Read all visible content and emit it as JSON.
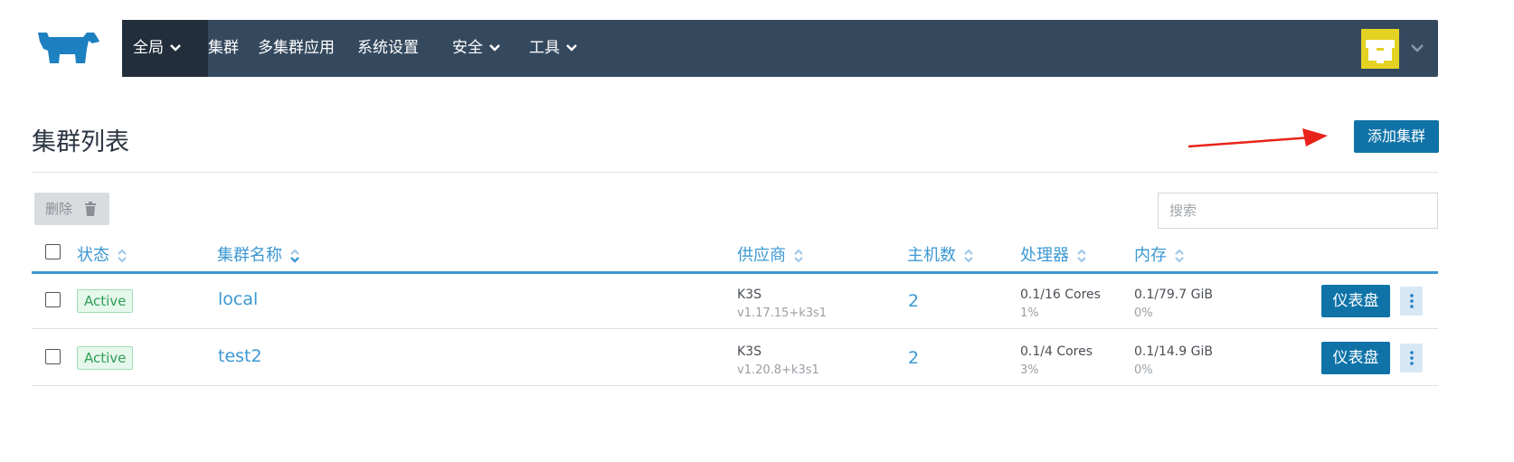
{
  "nav": {
    "items": [
      {
        "label": "全局",
        "has_dropdown": true,
        "active": true
      },
      {
        "label": "集群",
        "has_dropdown": false
      },
      {
        "label": "多集群应用",
        "has_dropdown": false
      },
      {
        "label": "系统设置",
        "has_dropdown": false
      },
      {
        "label": "安全",
        "has_dropdown": true
      },
      {
        "label": "工具",
        "has_dropdown": true
      }
    ],
    "colors": {
      "bar": "#35495e",
      "active": "#222e3b",
      "avatar": "#e4d223"
    }
  },
  "page": {
    "title": "集群列表",
    "add_button": "添加集群"
  },
  "toolbar": {
    "delete_label": "删除",
    "search_placeholder": "搜索"
  },
  "table": {
    "headers": [
      "状态",
      "集群名称",
      "供应商",
      "主机数",
      "处理器",
      "内存"
    ],
    "rows": [
      {
        "status": "Active",
        "name": "local",
        "provider": "K3S",
        "provider_version": "v1.17.15+k3s1",
        "nodes": "2",
        "cpu": "0.1/16 Cores",
        "cpu_pct": "1%",
        "memory": "0.1/79.7 GiB",
        "memory_pct": "0%",
        "dashboard": "仪表盘"
      },
      {
        "status": "Active",
        "name": "test2",
        "provider": "K3S",
        "provider_version": "v1.20.8+k3s1",
        "nodes": "2",
        "cpu": "0.1/4 Cores",
        "cpu_pct": "3%",
        "memory": "0.1/14.9 GiB",
        "memory_pct": "0%",
        "dashboard": "仪表盘"
      }
    ]
  },
  "colors": {
    "link": "#3d98d3",
    "primary_button": "#0f73a8",
    "status_active": "#2d9f55",
    "annotation_arrow": "#e8231b"
  }
}
